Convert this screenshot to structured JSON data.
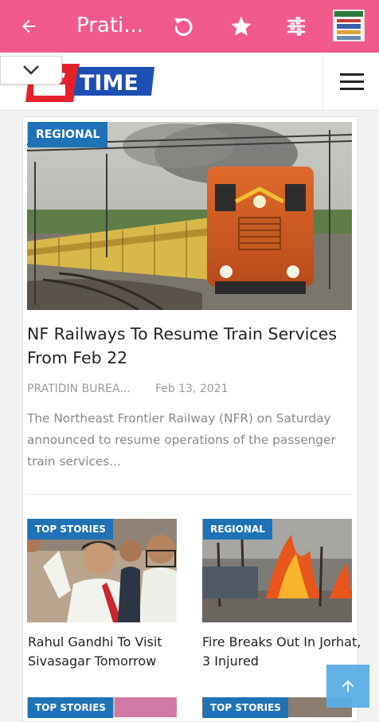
{
  "app_bar": {
    "title": "Prati...",
    "back_icon": "arrow-left-icon",
    "reload_icon": "reload-icon",
    "star_icon": "star-icon",
    "settings_icon": "sliders-icon",
    "color": "#f25a8b"
  },
  "site": {
    "logo_text": "TIME",
    "logo_script": "প্রতিদিন",
    "collapse_icon": "chevron-down-icon",
    "menu_icon": "hamburger-icon",
    "tag_color": "#1f72b6"
  },
  "lead": {
    "tag": "REGIONAL",
    "title": "NF Railways To Resume Train Services From Feb 22",
    "author": "PRATIDIN BUREA...",
    "date": "Feb 13, 2021",
    "excerpt": "The Northeast Frontier Railway (NFR) on Saturday announced to resume operations of the passenger train services..."
  },
  "grid": [
    {
      "tag": "TOP STORIES",
      "title": "Rahul Gandhi To Visit Sivasagar Tomorrow"
    },
    {
      "tag": "REGIONAL",
      "title": "Fire Breaks Out In Jorhat, 3 Injured"
    },
    {
      "tag": "TOP STORIES",
      "title": ""
    },
    {
      "tag": "TOP STORIES",
      "title": ""
    }
  ],
  "fab_icon": "arrow-up-icon"
}
